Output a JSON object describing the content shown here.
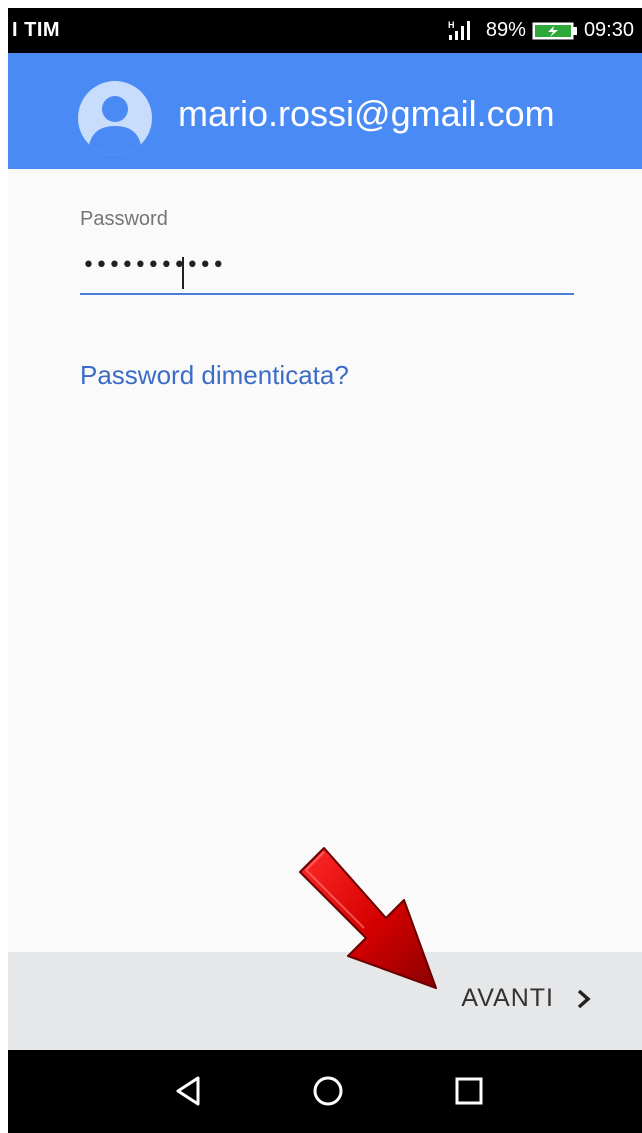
{
  "status_bar": {
    "carrier": "I TIM",
    "network_type": "H",
    "battery_percent": "89%",
    "time": "09:30"
  },
  "header": {
    "email": "mario.rossi@gmail.com",
    "background_color": "#4a8af4"
  },
  "form": {
    "password_label": "Password",
    "password_value": "•••••••••••",
    "forgot_link": "Password dimenticata?"
  },
  "footer": {
    "next_label": "AVANTI",
    "next_icon": "chevron-right-icon"
  },
  "annotation": {
    "icon": "red-arrow-icon",
    "color": "#d40000"
  },
  "nav_bar": {
    "back_icon": "back-triangle-icon",
    "home_icon": "home-circle-icon",
    "recents_icon": "recents-square-icon"
  }
}
